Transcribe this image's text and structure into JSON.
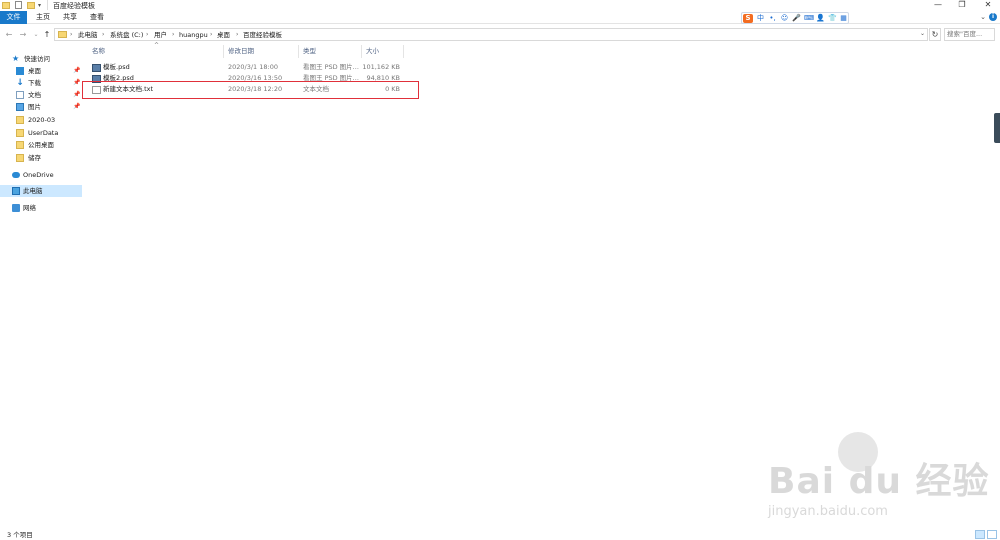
{
  "window": {
    "title": "百度经验模板",
    "controls": {
      "minimize": "—",
      "maximize": "❐",
      "close": "✕"
    }
  },
  "ribbon": {
    "tabs": [
      "文件",
      "主页",
      "共享",
      "查看"
    ],
    "expand": "⌄",
    "help": "i"
  },
  "ime": {
    "logo": "S",
    "icons": [
      "中",
      "•,",
      "☺",
      "🎤",
      "⌨",
      "👤",
      "👕",
      "▦"
    ]
  },
  "navigation": {
    "back": "←",
    "forward": "→",
    "recent": "⌄",
    "up": "↑"
  },
  "address": {
    "crumbs": [
      "此电脑",
      "系统盘 (C:)",
      "用户",
      "huangpu",
      "桌面",
      "百度经验模板"
    ],
    "separator": "›",
    "dropdown": "⌄",
    "refresh": "↻"
  },
  "search": {
    "placeholder": "搜索\"百度..."
  },
  "sidebar": {
    "items": [
      {
        "label": "快速访问",
        "icon": "star-icon",
        "pinned": false
      },
      {
        "label": "桌面",
        "icon": "desktop-icon",
        "pinned": true
      },
      {
        "label": "下载",
        "icon": "download-icon",
        "pinned": true
      },
      {
        "label": "文档",
        "icon": "document-icon",
        "pinned": true
      },
      {
        "label": "图片",
        "icon": "picture-icon",
        "pinned": true
      },
      {
        "label": "2020-03",
        "icon": "folder-icon",
        "pinned": false
      },
      {
        "label": "UserData",
        "icon": "folder-icon",
        "pinned": false
      },
      {
        "label": "公用桌面",
        "icon": "folder-icon",
        "pinned": false
      },
      {
        "label": "储存",
        "icon": "folder-icon",
        "pinned": false
      },
      {
        "label": "OneDrive",
        "icon": "cloud-icon",
        "pinned": false
      },
      {
        "label": "此电脑",
        "icon": "computer-icon",
        "pinned": false,
        "selected": true
      },
      {
        "label": "网络",
        "icon": "network-icon",
        "pinned": false
      }
    ],
    "pin_glyph": "📌"
  },
  "file_list": {
    "sort_indicator": "^",
    "columns": [
      "名称",
      "修改日期",
      "类型",
      "大小"
    ],
    "rows": [
      {
        "name": "模板.psd",
        "modified": "2020/3/1 18:00",
        "type": "看图王 PSD 图片...",
        "size": "101,162 KB",
        "icon": "psd-file-icon"
      },
      {
        "name": "模板2.psd",
        "modified": "2020/3/16 13:50",
        "type": "看图王 PSD 图片...",
        "size": "94,810 KB",
        "icon": "psd-file-icon"
      },
      {
        "name": "新建文本文档.txt",
        "modified": "2020/3/18 12:20",
        "type": "文本文档",
        "size": "0 KB",
        "icon": "txt-file-icon"
      }
    ],
    "highlight_color": "#e0303a"
  },
  "status": {
    "item_count": "3 个项目"
  },
  "watermark": {
    "brand": "Bai du 经验",
    "url": "jingyan.baidu.com"
  },
  "colors": {
    "accent": "#1979ca",
    "selection": "#cce8ff",
    "highlight": "#e0303a"
  }
}
